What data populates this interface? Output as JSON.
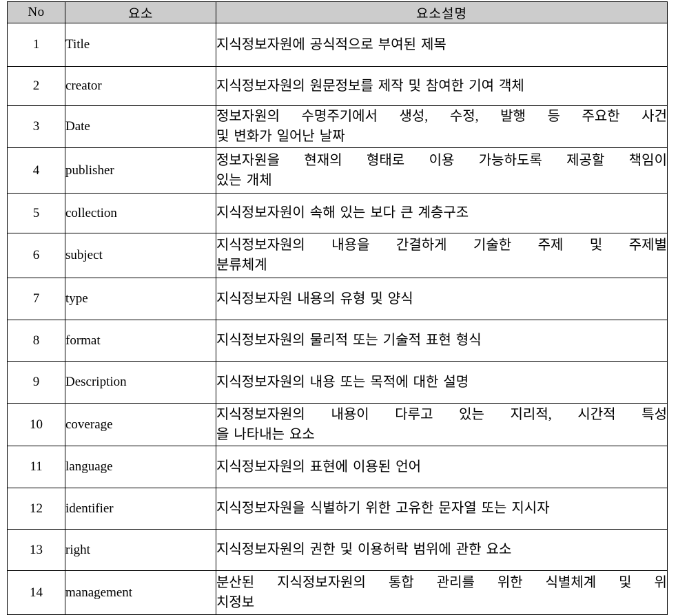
{
  "table": {
    "headers": {
      "no": "No",
      "element": "요소",
      "description": "요소설명"
    },
    "rows": [
      {
        "no": "1",
        "element": "Title",
        "desc_lines": [
          "지식정보자원에 공식적으로 부여된 제목"
        ]
      },
      {
        "no": "2",
        "element": "creator",
        "desc_lines": [
          "지식정보자원의 원문정보를 제작 및 참여한 기여 객체"
        ]
      },
      {
        "no": "3",
        "element": "Date",
        "desc_lines": [
          "정보자원의 수명주기에서 생성, 수정, 발행 등 주요한 사건",
          "및 변화가 일어난 날짜"
        ]
      },
      {
        "no": "4",
        "element": "publisher",
        "desc_lines": [
          "정보자원을 현재의 형태로 이용 가능하도록 제공할 책임이",
          "있는 개체"
        ]
      },
      {
        "no": "5",
        "element": "collection",
        "desc_lines": [
          "지식정보자원이 속해 있는 보다 큰 계층구조"
        ]
      },
      {
        "no": "6",
        "element": "subject",
        "desc_lines": [
          "지식정보자원의 내용을 간결하게 기술한 주제 및 주제별",
          "분류체계"
        ]
      },
      {
        "no": "7",
        "element": "type",
        "desc_lines": [
          "지식정보자원 내용의 유형 및 양식"
        ]
      },
      {
        "no": "8",
        "element": "format",
        "desc_lines": [
          "지식정보자원의 물리적 또는 기술적 표현 형식"
        ]
      },
      {
        "no": "9",
        "element": "Description",
        "desc_lines": [
          "지식정보자원의 내용 또는 목적에 대한 설명"
        ]
      },
      {
        "no": "10",
        "element": "coverage",
        "desc_lines": [
          "지식정보자원의 내용이 다루고 있는 지리적, 시간적 특성",
          "을 나타내는 요소"
        ]
      },
      {
        "no": "11",
        "element": "language",
        "desc_lines": [
          "지식정보자원의 표현에 이용된 언어"
        ]
      },
      {
        "no": "12",
        "element": "identifier",
        "desc_lines": [
          "지식정보자원을 식별하기 위한 고유한 문자열 또는 지시자"
        ]
      },
      {
        "no": "13",
        "element": "right",
        "desc_lines": [
          "지식정보자원의 권한 및 이용허락 범위에 관한 요소"
        ]
      },
      {
        "no": "14",
        "element": "management",
        "desc_lines": [
          "분산된 지식정보자원의 통합 관리를 위한 식별체계 및 위",
          "치정보"
        ]
      }
    ]
  },
  "style": {
    "header_background": "#cccccc",
    "border_color": "#000000",
    "page_background": "#ffffff",
    "text_color": "#000000"
  }
}
